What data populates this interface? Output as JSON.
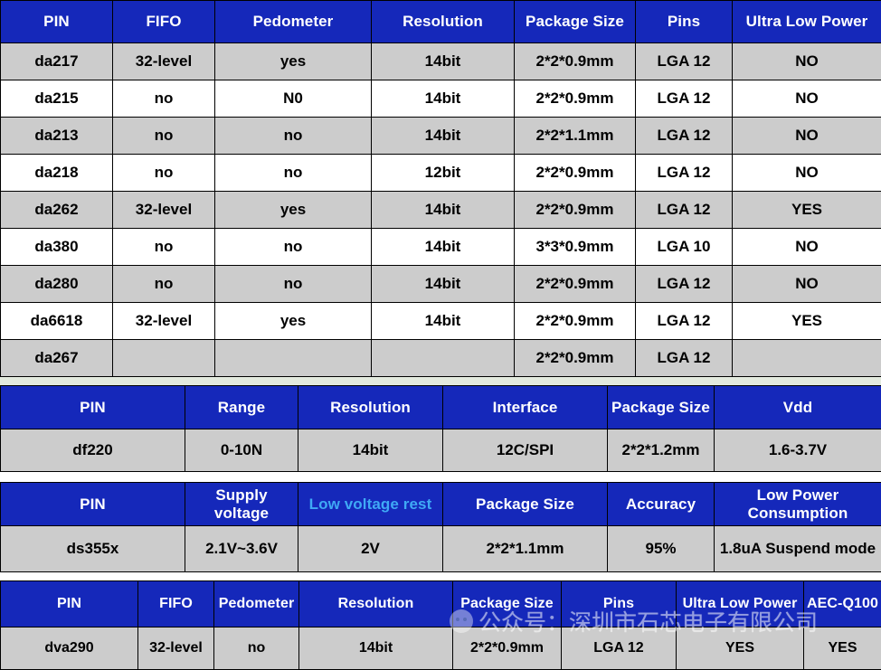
{
  "colors": {
    "header_blue": "#1528ba",
    "header_text": "#ffffff",
    "accent_cyan": "#3fa9f5",
    "row_shaded": "#cccccc",
    "row_plain": "#ffffff",
    "grid_line": "#000000",
    "gap_tint": "#e3eade"
  },
  "tables": [
    {
      "id": "accelerometer-table",
      "columns": [
        "PIN",
        "FIFO",
        "Pedometer",
        "Resolution",
        "Package Size",
        "Pins",
        "Ultra Low Power"
      ],
      "rows": [
        [
          "da217",
          "32-level",
          "yes",
          "14bit",
          "2*2*0.9mm",
          "LGA 12",
          "NO"
        ],
        [
          "da215",
          "no",
          "N0",
          "14bit",
          "2*2*0.9mm",
          "LGA 12",
          "NO"
        ],
        [
          "da213",
          "no",
          "no",
          "14bit",
          "2*2*1.1mm",
          "LGA 12",
          "NO"
        ],
        [
          "da218",
          "no",
          "no",
          "12bit",
          "2*2*0.9mm",
          "LGA 12",
          "NO"
        ],
        [
          "da262",
          "32-level",
          "yes",
          "14bit",
          "2*2*0.9mm",
          "LGA 12",
          "YES"
        ],
        [
          "da380",
          "no",
          "no",
          "14bit",
          "3*3*0.9mm",
          "LGA 10",
          "NO"
        ],
        [
          "da280",
          "no",
          "no",
          "14bit",
          "2*2*0.9mm",
          "LGA 12",
          "NO"
        ],
        [
          "da6618",
          "32-level",
          "yes",
          "14bit",
          "2*2*0.9mm",
          "LGA 12",
          "YES"
        ],
        [
          "da267",
          "",
          "",
          "",
          "2*2*0.9mm",
          "LGA 12",
          ""
        ]
      ]
    },
    {
      "id": "force-sensor-table",
      "columns": [
        "PIN",
        "Range",
        "Resolution",
        "Interface",
        "Package Size",
        "Vdd"
      ],
      "rows": [
        [
          "df220",
          "0-10N",
          "14bit",
          "12C/SPI",
          "2*2*1.2mm",
          "1.6-3.7V"
        ]
      ]
    },
    {
      "id": "sensor-power-table",
      "columns": [
        "PIN",
        "Supply voltage",
        "Low voltage rest",
        "Package Size",
        "Accuracy",
        "Low Power Consumption"
      ],
      "accent_column_index": 2,
      "rows": [
        [
          "ds355x",
          "2.1V~3.6V",
          "2V",
          "2*2*1.1mm",
          "95%",
          "1.8uA Suspend mode"
        ]
      ]
    },
    {
      "id": "automotive-table",
      "columns": [
        "PIN",
        "FIFO",
        "Pedometer",
        "Resolution",
        "Package Size",
        "Pins",
        "Ultra Low Power",
        "AEC-Q100"
      ],
      "rows": [
        [
          "dva290",
          "32-level",
          "no",
          "14bit",
          "2*2*0.9mm",
          "LGA 12",
          "YES",
          "YES"
        ]
      ]
    }
  ],
  "watermark": {
    "icon": "wechat-icon",
    "text": "公众号：深圳市石芯电子有限公司"
  }
}
